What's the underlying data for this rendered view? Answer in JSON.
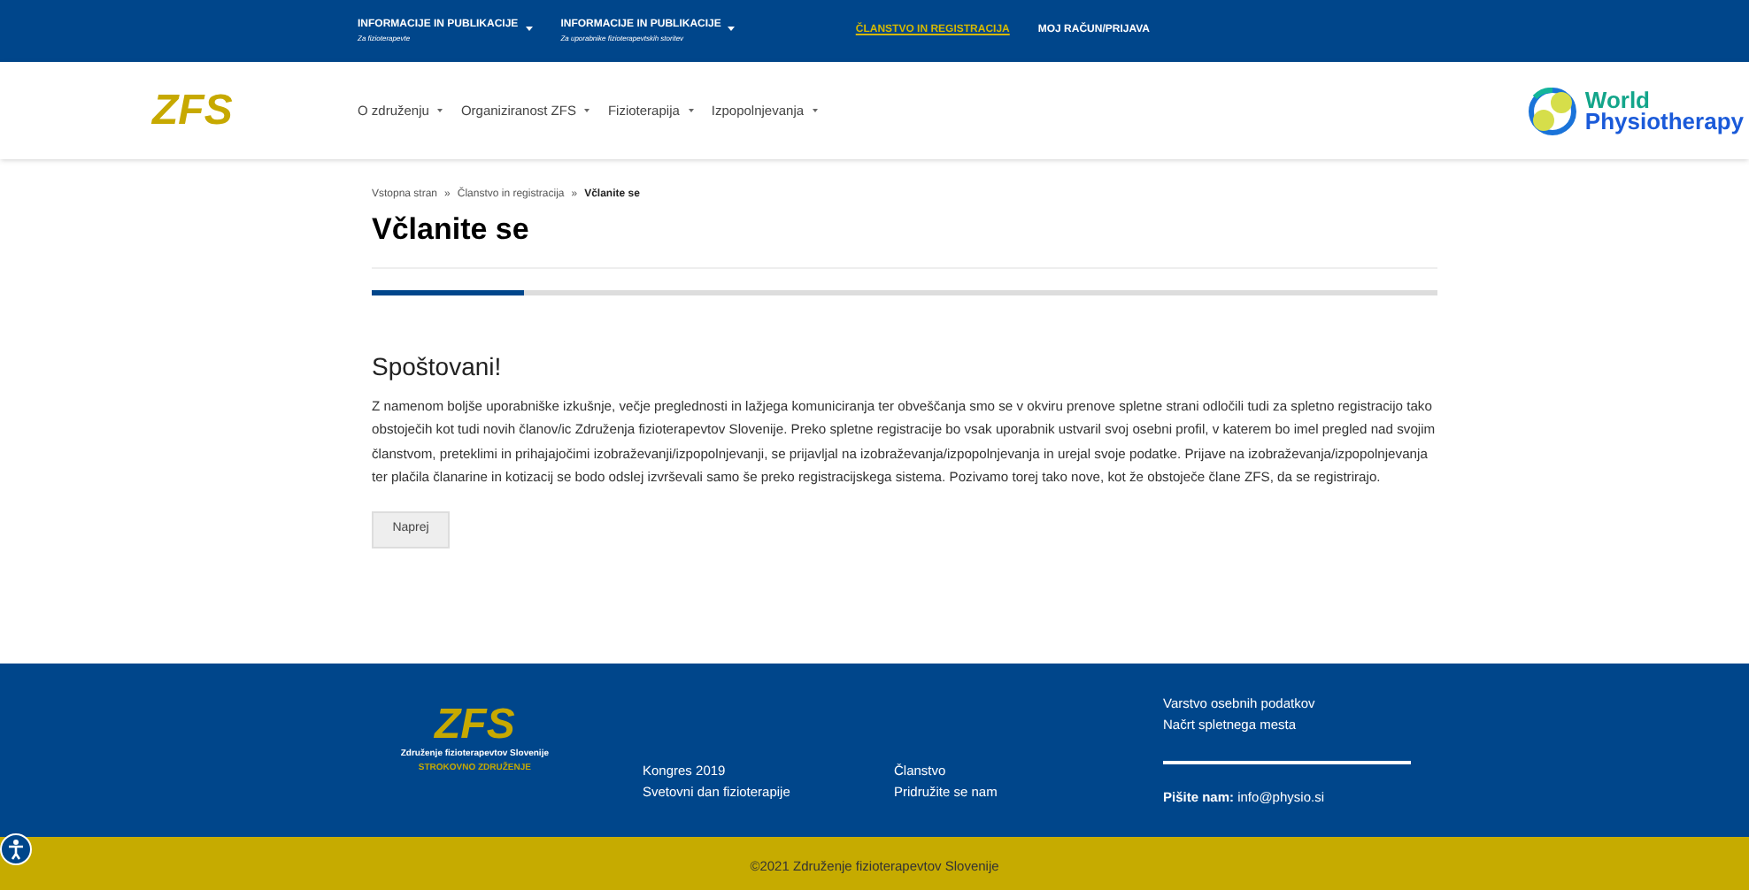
{
  "top_bar": {
    "items": [
      {
        "label": "INFORMACIJE IN PUBLIKACIJE",
        "sub": "Za fizioterapevte",
        "kind": "dropdown",
        "selected": false
      },
      {
        "label": "INFORMACIJE IN PUBLIKACIJE",
        "sub": "Za uporabnike fizioterapevtskih storitev",
        "kind": "dropdown",
        "selected": false
      },
      {
        "label": "ČLANSTVO IN REGISTRACIJA",
        "kind": "link",
        "selected": true
      },
      {
        "label": "MOJ RAČUN/PRIJAVA",
        "kind": "link",
        "selected": false
      }
    ]
  },
  "nav": {
    "logo": "ZFS",
    "items": [
      "O združenju",
      "Organiziranost ZFS",
      "Fizioterapija",
      "Izpopolnjevanja"
    ],
    "partner_logo": [
      "World",
      "Physiotherapy"
    ]
  },
  "breadcrumb": [
    "Vstopna stran",
    "Članstvo in registracija",
    "Včlanite se"
  ],
  "breadcrumb_separators": [
    "»",
    "»"
  ],
  "title": "Včlanite se",
  "progress": {
    "level": 0.143
  },
  "greeting": "Spoštovani!",
  "body": "Z namenom boljše uporabniške izkušnje, večje preglednosti in lažjega komuniciranja ter obveščanja smo se v okviru prenove spletne strani odločili tudi za spletno registracijo tako obstoječih kot tudi novih članov/ic Združenja fizioterapevtov Slovenije. Preko spletne registracije bo vsak uporabnik ustvaril svoj osebni profil, v katerem bo imel pregled nad svojim članstvom, preteklimi in prihajajočimi izobraževanji/izpopolnjevanji, se prijavljal na izobraževanja/izpopolnjevanja in urejal svoje podatke. Prijave na izobraževanja/izpopolnjevanja ter plačila članarine in kotizacij se bodo odslej izvrševali samo še preko registracijskega sistema. Pozivamo torej tako nove, kot že obstoječe člane ZFS, da se registrirajo.",
  "button": "Naprej",
  "footer": {
    "logo": "ZFS",
    "logo_line1": "Združenje fizioterapevtov Slovenije",
    "logo_line2": "STROKOVNO ZDRUŽENJE",
    "col1": [
      "Kongres 2019",
      "Svetovni dan fizioterapije"
    ],
    "col2": [
      "Članstvo",
      "Pridružite se nam"
    ],
    "col3": [
      "Varstvo osebnih podatkov",
      "Načrt spletnega mesta"
    ],
    "contact": "**Pišite nam:** info@physio.si",
    "copyright": "©2021 Združenje fizioterapevtov Slovenije"
  }
}
